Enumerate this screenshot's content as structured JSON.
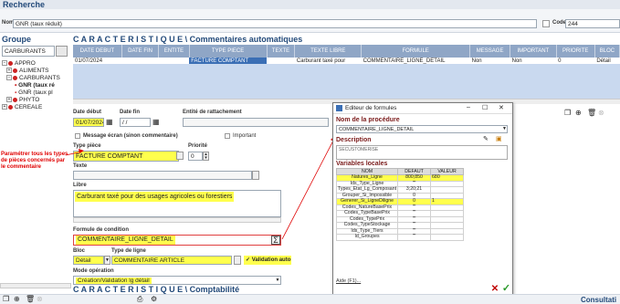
{
  "recherche": {
    "title": "Recherche",
    "nom_label": "Nom",
    "nom_value": "GNR (taux réduit)",
    "code_label": "Code",
    "code_value": "244"
  },
  "groupe": {
    "title": "Groupe",
    "value": "CARBURANTS",
    "tree": [
      {
        "label": "APPRO",
        "level": 0
      },
      {
        "label": "ALIMENTS",
        "level": 1
      },
      {
        "label": "CARBURANTS",
        "level": 1
      },
      {
        "label": "GNR (taux ré",
        "level": 2
      },
      {
        "label": "GNR (taux pl",
        "level": 2
      },
      {
        "label": "PHYTO",
        "level": 1
      },
      {
        "label": "CEREALE",
        "level": 0
      }
    ]
  },
  "characteristics": {
    "title": "C A R A C T E R I S T I Q U E \\ Commentaires automatiques",
    "columns": [
      "DATE DEBUT",
      "DATE FIN",
      "ENTITE",
      "TYPE PIECE",
      "TEXTE",
      "TEXTE LIBRE",
      "FORMULE",
      "MESSAGE",
      "IMPORTANT",
      "PRIORITE",
      "BLOC"
    ],
    "rows": [
      [
        "01/07/2024",
        "",
        "",
        "FACTURE COMPTANT",
        "",
        "Carburant taxé pour",
        "COMMENTAIRE_LIGNE_DETAIL",
        "Non",
        "Non",
        "0",
        "Détail"
      ]
    ]
  },
  "form": {
    "date_debut_label": "Date début",
    "date_debut": "01/07/2024",
    "date_fin_label": "Date fin",
    "date_fin": "/ /",
    "entite_label": "Entité de rattachement",
    "message_label": "Message écran (sinon commentaire)",
    "important_label": "Important",
    "type_piece_label": "Type pièce",
    "type_piece": "FACTURE COMPTANT",
    "priorite_label": "Priorité",
    "priorite": "0",
    "texte_label": "Texte",
    "libre_label": "Libre",
    "libre_value": "Carburant taxé pour des usages agricoles ou forestiers",
    "formule_label": "Formule de condition",
    "formule_value": "COMMENTAIRE_LIGNE_DETAIL",
    "sigma": "Σ",
    "bloc_label": "Bloc",
    "bloc_value": "Détail",
    "type_ligne_label": "Type de ligne",
    "type_ligne_value": "COMMENTAIRE ARTICLE",
    "validation_label": "Validation auto",
    "mode_label": "Mode opération",
    "mode_value": "Création/Validation lg détail"
  },
  "annotation": {
    "text": "Paramétrer tous les types de pièces concernés par le commentaire",
    "color": "#e00000"
  },
  "dialog": {
    "title": "Editeur de formules",
    "nom_label": "Nom de la procédure",
    "nom_value": "COMMENTAIRE_LIGNE_DETAIL",
    "description_label": "Description",
    "description_value": "SECUSTOMERISE",
    "variables_label": "Variables locales",
    "columns": [
      "NOM",
      "DEFAUT",
      "VALEUR"
    ],
    "rows": [
      {
        "nom": "Natures_Ligne",
        "defaut": "800;850",
        "valeur": "680",
        "hi": true
      },
      {
        "nom": "Ids_Type_Ligne",
        "defaut": "\"\"",
        "valeur": "",
        "hi": false
      },
      {
        "nom": "Types_Etat_Lg_Composant",
        "defaut": "3;20;21",
        "valeur": "",
        "hi": false
      },
      {
        "nom": "Grouper_Si_Impossible",
        "defaut": "0",
        "valeur": "",
        "hi": false
      },
      {
        "nom": "Generer_Si_LigneDiligne",
        "defaut": "0",
        "valeur": "1",
        "hi": true
      },
      {
        "nom": "Codes_NatureBasePrix",
        "defaut": "\"\"",
        "valeur": "",
        "hi": false
      },
      {
        "nom": "Codes_TypeBasePrix",
        "defaut": "\"\"",
        "valeur": "",
        "hi": false
      },
      {
        "nom": "Codes_TypePrix",
        "defaut": "\"\"",
        "valeur": "",
        "hi": false
      },
      {
        "nom": "Codes_TypeStockage",
        "defaut": "\"\"",
        "valeur": "",
        "hi": false
      },
      {
        "nom": "Ids_Type_Tiers",
        "defaut": "\"\"",
        "valeur": "",
        "hi": false
      },
      {
        "nom": "Id_Groupes",
        "defaut": "\"\"",
        "valeur": "",
        "hi": false
      }
    ],
    "aide_label": "Aide (F1)..."
  },
  "bottom": {
    "compat_title": "C A R A C T E R I S T I Q U E \\ Comptabilité",
    "consultation": "Consultati"
  }
}
